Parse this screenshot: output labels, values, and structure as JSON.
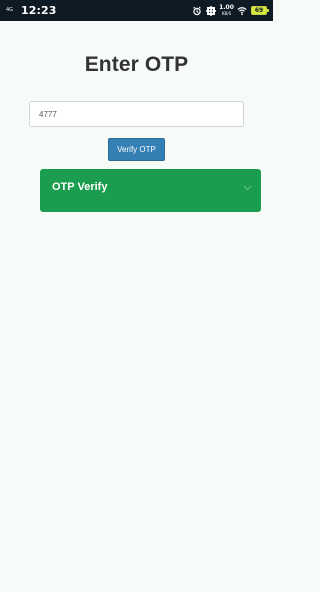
{
  "status_bar": {
    "time": "12:23",
    "left_signal": "4G",
    "speed_value": "1.00",
    "speed_unit": "KB/S",
    "battery_level": "69",
    "icons": [
      "alarm-icon",
      "location-icon",
      "network-speed-indicator",
      "wifi-icon",
      "battery-icon"
    ]
  },
  "page": {
    "title": "Enter OTP"
  },
  "form": {
    "otp_value": "4777",
    "verify_label": "Verify OTP"
  },
  "alert": {
    "text": "OTP Verify",
    "dismiss_icon": "dropdown-chevron-icon"
  },
  "colors": {
    "background": "#f7fbf7",
    "status_bar": "#0f1b24",
    "primary_button": "#347fb3",
    "success_alert": "#1b9d4f",
    "battery": "#d7e843"
  }
}
